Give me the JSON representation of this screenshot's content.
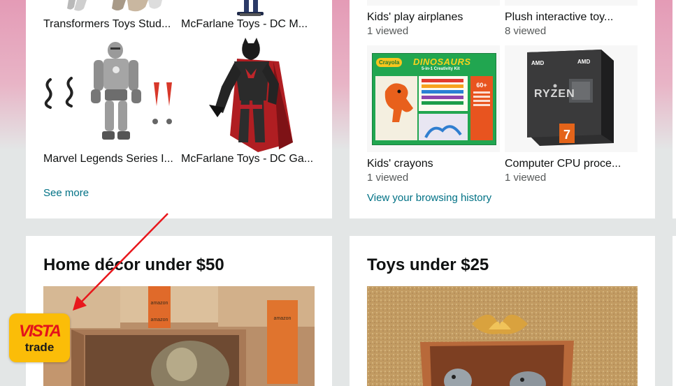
{
  "left_card_top": {
    "tiles": [
      {
        "label": "Transformers Toys Stud..."
      },
      {
        "label": "McFarlane Toys - DC M..."
      },
      {
        "label": "Marvel Legends Series I..."
      },
      {
        "label": "McFarlane Toys - DC Ga..."
      }
    ],
    "see_more": "See more"
  },
  "right_card_top": {
    "tiles": [
      {
        "label": "Kids' play airplanes",
        "sub": "1 viewed"
      },
      {
        "label": "Plush interactive toy...",
        "sub": "8 viewed"
      },
      {
        "label": "Kids' crayons",
        "sub": "1 viewed"
      },
      {
        "label": "Computer CPU proce...",
        "sub": "1 viewed"
      }
    ],
    "crayola_brand": "Crayola",
    "crayola_product": "DINOSAURS",
    "crayola_subtitle": "5-in-1 Creativity Kit",
    "crayola_count": "60+",
    "cpu_brand": "AMD",
    "cpu_name": "RYZEN",
    "cpu_tier": "7",
    "history_link": "View your browsing history"
  },
  "home_decor_card": {
    "title": "Home décor under $50",
    "box_print": "amazon"
  },
  "toys_card": {
    "title": "Toys under $25"
  },
  "badge": {
    "line1": "VISTA",
    "line2": "trade"
  },
  "colors": {
    "link": "#007185",
    "text": "#0f1111",
    "muted": "#565959",
    "page_bg": "#e3e6e6",
    "banner_pink": "#e49bb6",
    "badge_yellow": "#fbbd08",
    "badge_red": "#e4131b",
    "arrow_red": "#e8171c"
  }
}
